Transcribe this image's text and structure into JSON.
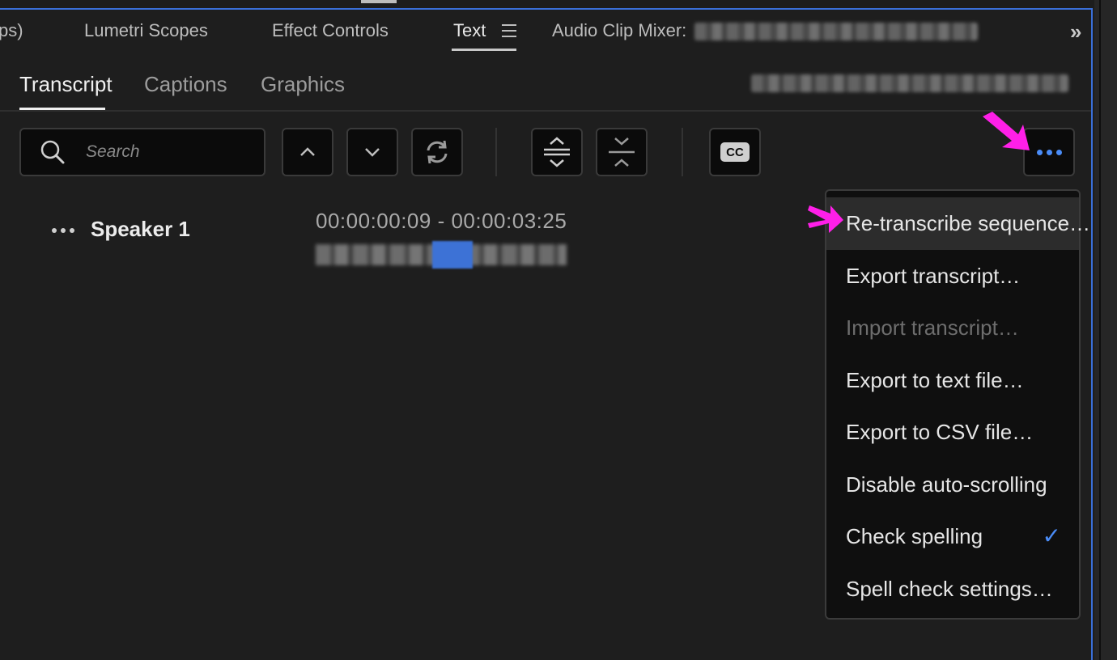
{
  "panel_tabs": {
    "partial_left": "ps)",
    "lumetri": "Lumetri Scopes",
    "effect_controls": "Effect Controls",
    "text": "Text",
    "audio_clip_mixer": "Audio Clip Mixer:",
    "overflow_icon": "double-chevron-right-icon"
  },
  "sub_tabs": {
    "transcript": "Transcript",
    "captions": "Captions",
    "graphics": "Graphics"
  },
  "toolbar": {
    "search_placeholder": "Search",
    "cc_label": "CC"
  },
  "transcript": {
    "speaker": "Speaker 1",
    "timecode": "00:00:00:09 - 00:00:03:25"
  },
  "menu": {
    "items": [
      {
        "label": "Re-transcribe sequence…",
        "enabled": true
      },
      {
        "label": "Export transcript…",
        "enabled": true
      },
      {
        "label": "Import transcript…",
        "enabled": false
      },
      {
        "label": "Export to text file…",
        "enabled": true
      },
      {
        "label": "Export to CSV file…",
        "enabled": true
      },
      {
        "label": "Disable auto-scrolling",
        "enabled": true
      },
      {
        "label": "Check spelling",
        "enabled": true,
        "checked": true
      },
      {
        "label": "Spell check settings…",
        "enabled": true
      }
    ]
  },
  "colors": {
    "accent": "#4a8cf7",
    "annotation": "#ff1fe8",
    "panel_border": "#3a6fd8"
  }
}
